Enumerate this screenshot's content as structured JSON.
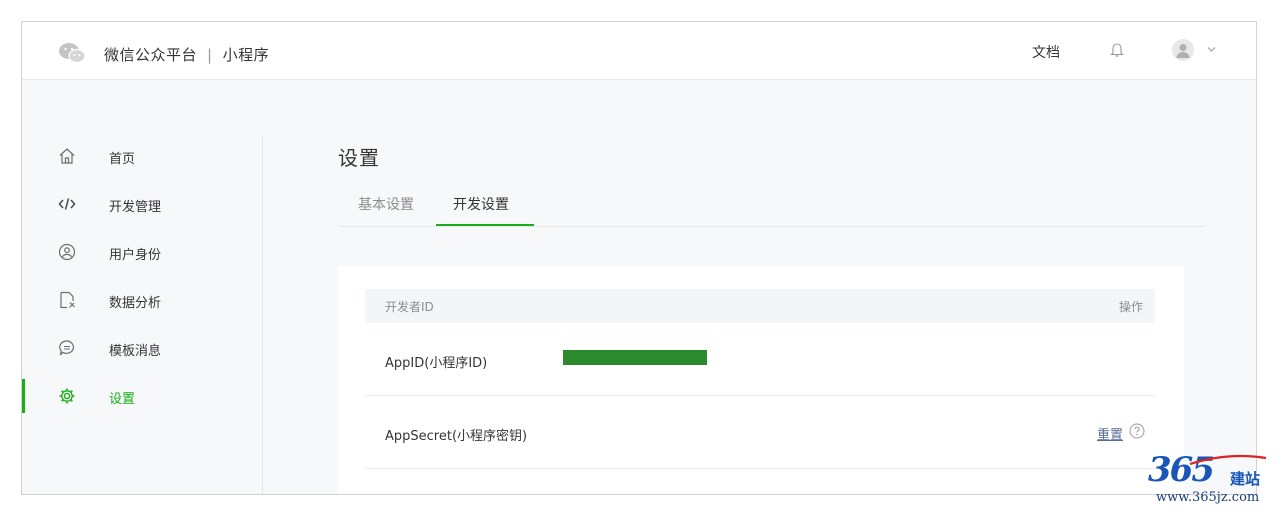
{
  "header": {
    "brand": "微信公众平台",
    "separator": "|",
    "product": "小程序",
    "doc_link": "文档"
  },
  "sidebar": {
    "items": [
      {
        "label": "首页",
        "icon": "home-icon"
      },
      {
        "label": "开发管理",
        "icon": "code-icon"
      },
      {
        "label": "用户身份",
        "icon": "user-circle-icon"
      },
      {
        "label": "数据分析",
        "icon": "data-doc-icon"
      },
      {
        "label": "模板消息",
        "icon": "message-icon"
      },
      {
        "label": "设置",
        "icon": "gear-icon",
        "active": true
      }
    ]
  },
  "main": {
    "title": "设置",
    "tabs": [
      {
        "label": "基本设置"
      },
      {
        "label": "开发设置",
        "active": true
      }
    ],
    "table": {
      "header_left": "开发者ID",
      "header_right": "操作",
      "rows": [
        {
          "label": "AppID(小程序ID)"
        },
        {
          "label": "AppSecret(小程序密钥)",
          "action": "重置"
        }
      ]
    }
  },
  "watermark": {
    "number": "365",
    "name": "建站",
    "url": "www.365jz.com"
  },
  "colors": {
    "accent": "#1aad19",
    "link": "#576b95",
    "redaction": "#2b8a2b",
    "watermark": "#1a56b8"
  }
}
